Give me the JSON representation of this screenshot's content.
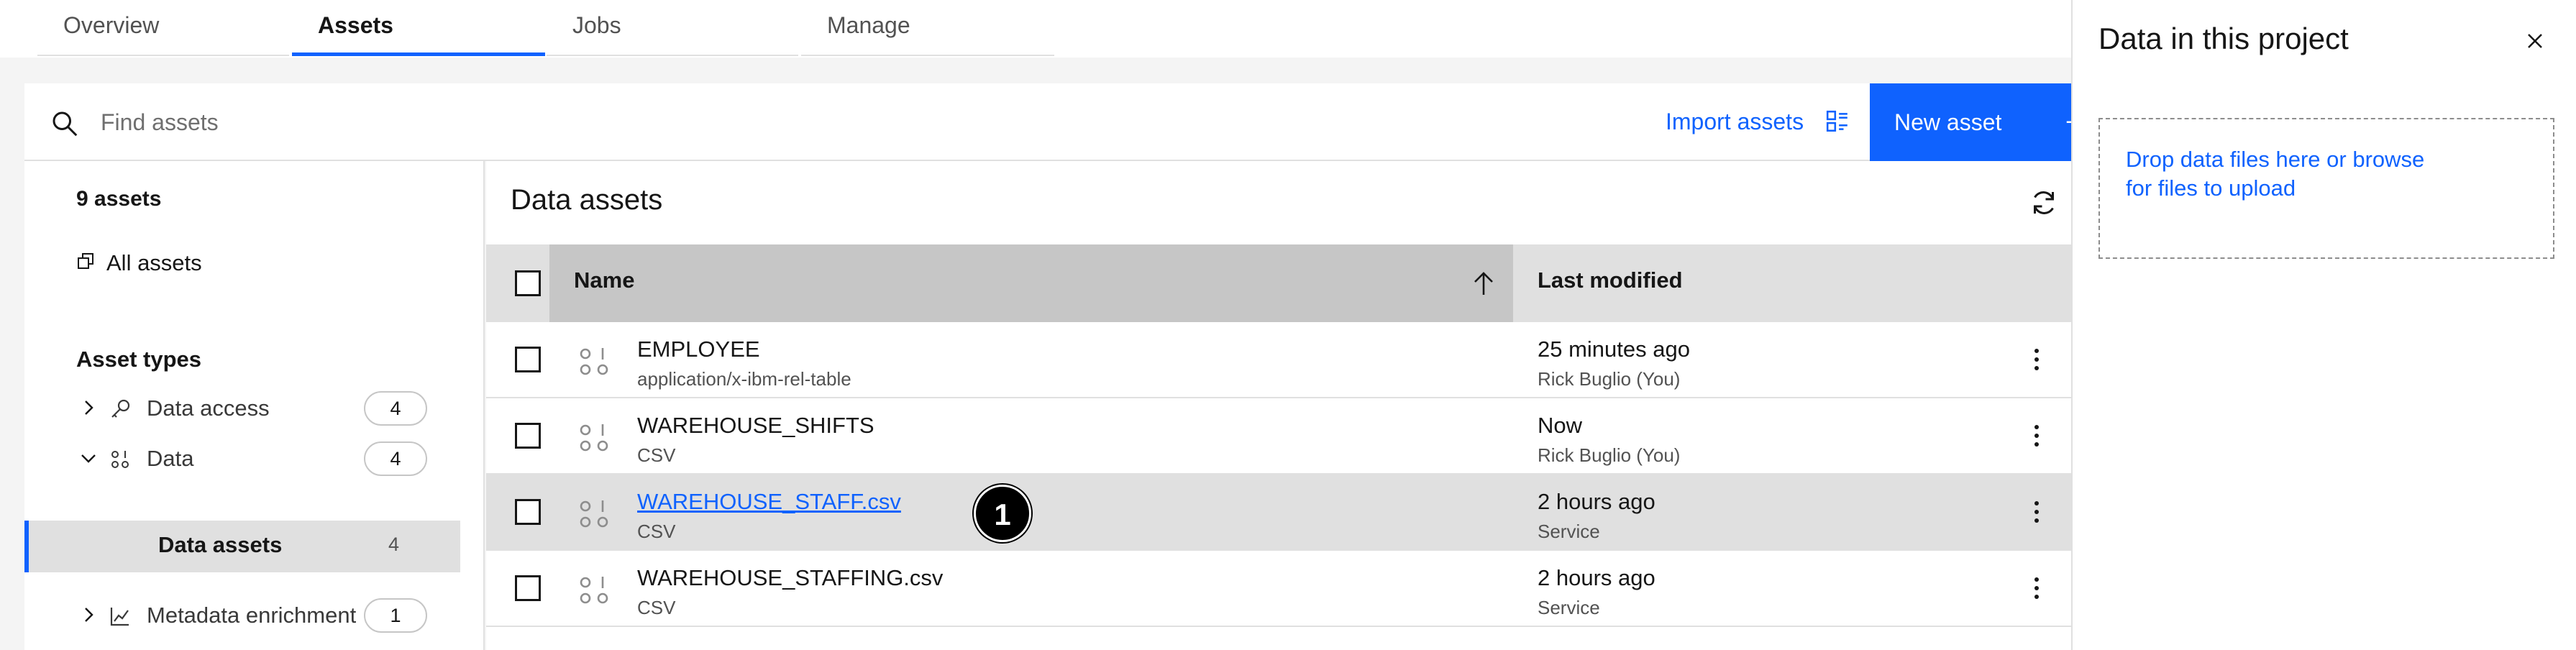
{
  "tabs": [
    {
      "label": "Overview"
    },
    {
      "label": "Assets"
    },
    {
      "label": "Jobs"
    },
    {
      "label": "Manage"
    }
  ],
  "toolbar": {
    "search_placeholder": "Find assets",
    "import_label": "Import assets",
    "new_label": "New asset",
    "new_icon": "+"
  },
  "left": {
    "count": "9 assets",
    "all_assets": "All assets",
    "asset_types_heading": "Asset types",
    "types": [
      {
        "label": "Data access",
        "count": "4"
      },
      {
        "label": "Data",
        "count": "4"
      },
      {
        "label": "Data assets",
        "count": "4"
      },
      {
        "label": "Metadata enrichment",
        "count": "1"
      }
    ]
  },
  "main": {
    "title": "Data assets",
    "col_name": "Name",
    "col_modified": "Last modified",
    "rows": [
      {
        "name": "EMPLOYEE",
        "type": "application/x-ibm-rel-table",
        "modified": "25 minutes ago",
        "by": "Rick Buglio (You)"
      },
      {
        "name": "WAREHOUSE_SHIFTS",
        "type": "CSV",
        "modified": "Now",
        "by": "Rick Buglio (You)"
      },
      {
        "name": "WAREHOUSE_STAFF.csv",
        "type": "CSV",
        "modified": "2 hours ago",
        "by": "Service"
      },
      {
        "name": "WAREHOUSE_STAFFING.csv",
        "type": "CSV",
        "modified": "2 hours ago",
        "by": "Service"
      }
    ],
    "marker": "1"
  },
  "drawer": {
    "title": "Data in this project",
    "drop_text": "Drop data files here or browse for files to upload"
  },
  "colors": {
    "accent": "#0f62fe",
    "header_bg": "#e0e0e0"
  }
}
